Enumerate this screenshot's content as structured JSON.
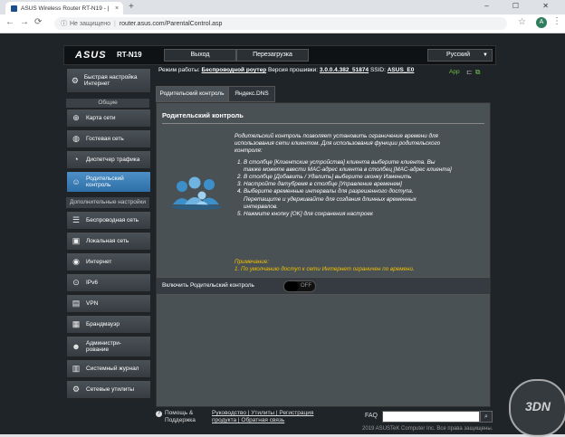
{
  "browser": {
    "tab_title": "ASUS Wireless Router RT-N19 - | ",
    "tab_close": "×",
    "new_tab": "+",
    "window_controls": "– ☐ ✕",
    "back": "←",
    "forward": "→",
    "reload": "⟳",
    "security": "Не защищено",
    "url": "router.asus.com/ParentalControl.asp",
    "profile_initial": "A",
    "star": "☆",
    "menu": "⋮"
  },
  "header": {
    "logo": "ASUS",
    "model": "RT-N19",
    "logout": "Выход",
    "reboot": "Перезагрузка",
    "language": "Русский"
  },
  "status": {
    "mode_label": "Режим работы:",
    "mode_value": "Беспроводной роутер",
    "fw_label": "Версия прошивки:",
    "fw_value": "3.0.0.4.382_51874",
    "ssid_label": "SSID:",
    "ssid_value": "ASUS_E0",
    "app": "App"
  },
  "sidebar": {
    "quick_setup": "Быстрая настройка Интернет",
    "group_general": "Общие",
    "items_general": [
      {
        "label": "Карта сети",
        "icon": "network-map-icon"
      },
      {
        "label": "Гостевая сеть",
        "icon": "guest-network-icon"
      },
      {
        "label": "Диспетчер трафика",
        "icon": "traffic-manager-icon"
      },
      {
        "label": "Родительский контроль",
        "icon": "parental-control-icon"
      }
    ],
    "group_advanced": "Дополнительные настройки",
    "items_advanced": [
      {
        "label": "Беспроводная сеть",
        "icon": "wireless-icon"
      },
      {
        "label": "Локальная сеть",
        "icon": "lan-icon"
      },
      {
        "label": "Интернет",
        "icon": "wan-icon"
      },
      {
        "label": "IPv6",
        "icon": "ipv6-icon"
      },
      {
        "label": "VPN",
        "icon": "vpn-icon"
      },
      {
        "label": "Брандмауэр",
        "icon": "firewall-icon"
      },
      {
        "label": "Администри-рование",
        "icon": "administration-icon"
      },
      {
        "label": "Системный журнал",
        "icon": "system-log-icon"
      },
      {
        "label": "Сетевые утилиты",
        "icon": "network-tools-icon"
      }
    ]
  },
  "tabs": [
    "Родительский контроль",
    "Яндекс.DNS"
  ],
  "panel": {
    "title": "Родительский контроль",
    "intro": "Родительский контроль позволяет установить ограничение времени для использования сети клиентом. Для использования функции родительского контроля:",
    "steps": [
      "В столбце [Клиентские устройства] клиента выберите клиента. Вы также можете ввести MAC-адрес клиента в столбец [MAC-адрес клиента]",
      "В столбце [Добавить / Удалить] выберите иконку Изменить",
      "Настройте датубремя в столбце [Управление временем]",
      "Выберите временные интервалы для разрешенного доступа. Перетащите и удерживайте для создания длинных временных интервалов.",
      "Нажмите кнопку [OK] для сохранения настроек"
    ],
    "note_title": "Примечание:",
    "note_item": "1. По умолчанию доступ к сети Интернет ограничен по времени.",
    "toggle_label": "Включить Родительский контроль",
    "toggle_state": "OFF"
  },
  "footer": {
    "help1": "Помощь &",
    "help2": "Поддержка",
    "links_line1": "Руководство | Утилиты | Регистрация",
    "links_line2": "продукта | Обратная связь",
    "faq": "FAQ",
    "search_btn": "⌕",
    "copyright": "2019 ASUSTeK Computer Inc. Все права защищены."
  },
  "watermark": "3DN"
}
